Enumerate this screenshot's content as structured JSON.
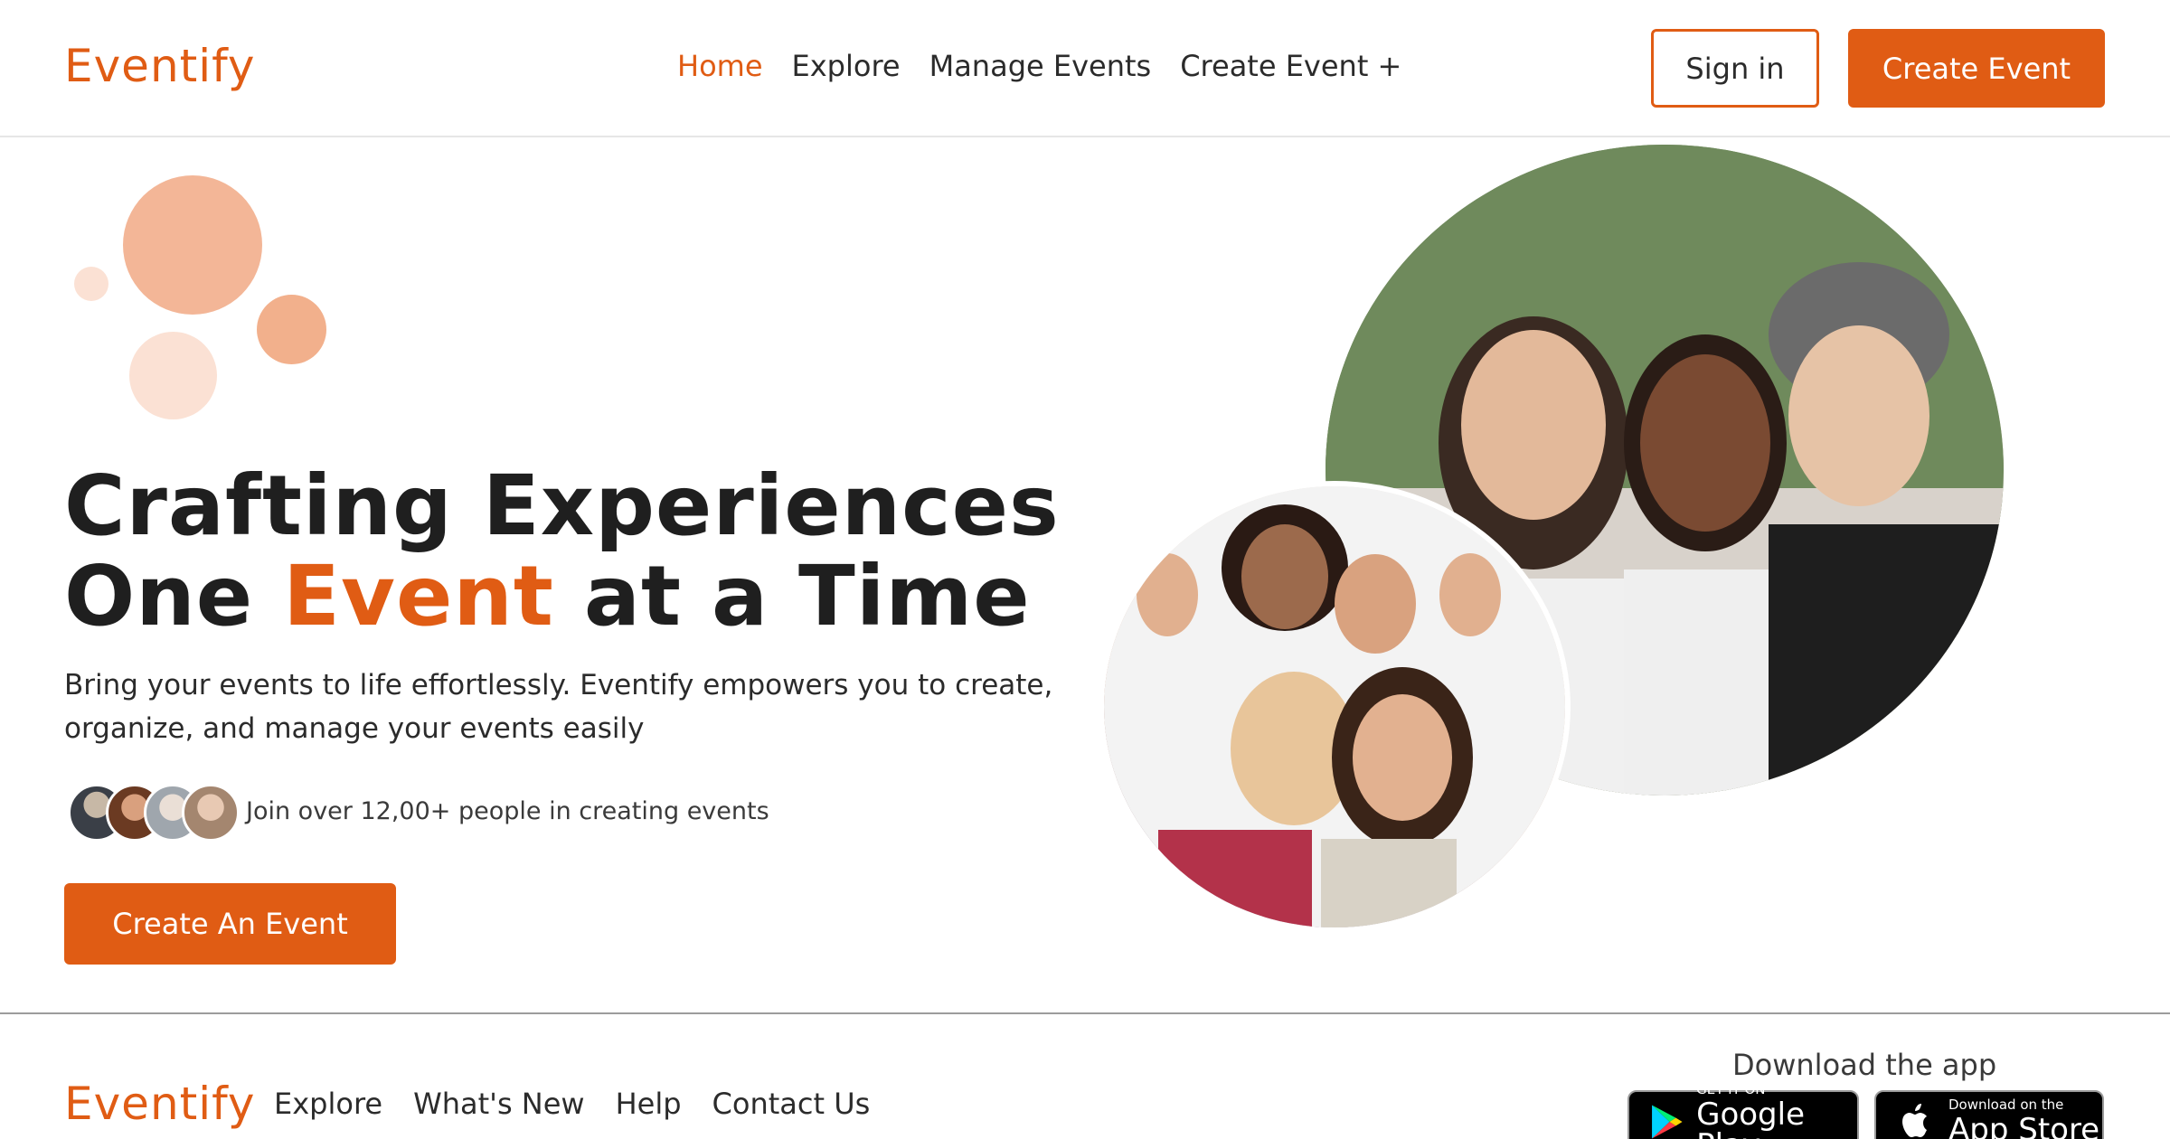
{
  "brand": {
    "name": "Eventify",
    "accent_color": "#e05c14"
  },
  "header": {
    "nav": [
      {
        "label": "Home",
        "active": true
      },
      {
        "label": "Explore",
        "active": false
      },
      {
        "label": "Manage Events",
        "active": false
      },
      {
        "label": "Create Event +",
        "active": false
      }
    ],
    "sign_in_label": "Sign in",
    "create_event_label": "Create Event"
  },
  "hero": {
    "title_line1": "Crafting Experiences",
    "title_line2_pre": "One ",
    "title_line2_accent": "Event",
    "title_line2_post": " at a Time",
    "subtitle": "Bring your events to life effortlessly. Eventify empowers you to create, organize, and manage your events easily",
    "join_text": "Join over 12,00+ people in creating events",
    "cta_label": "Create An Event"
  },
  "footer": {
    "nav": [
      {
        "label": "Explore"
      },
      {
        "label": "What's New"
      },
      {
        "label": "Help"
      },
      {
        "label": "Contact Us"
      }
    ],
    "download_label": "Download the app",
    "google_play": {
      "small": "GET IT ON",
      "big": "Google Play",
      "icon": "google-play-icon"
    },
    "app_store": {
      "small": "Download on the",
      "big": "App Store",
      "icon": "apple-icon"
    }
  }
}
